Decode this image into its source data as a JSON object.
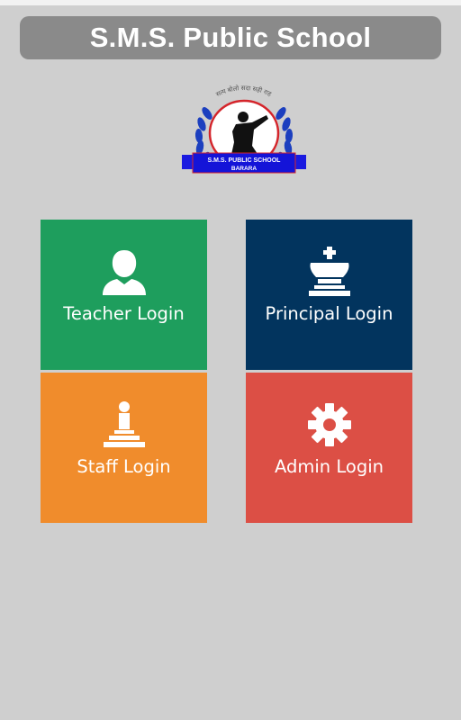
{
  "app": {
    "title": "S.M.S. Public School"
  },
  "logo": {
    "school_name": "S.M.S. PUBLIC SCHOOL",
    "location": "BARARA",
    "motto": "सत्य बोलो सदा सही राह"
  },
  "tiles": [
    {
      "label": "Teacher Login",
      "icon": "user-icon",
      "color": "#1e9e5d"
    },
    {
      "label": "Principal Login",
      "icon": "chess-king-icon",
      "color": "#02345e"
    },
    {
      "label": "Staff Login",
      "icon": "chess-pawn-icon",
      "color": "#f08c2c"
    },
    {
      "label": "Admin Login",
      "icon": "gear-icon",
      "color": "#dc4f45"
    }
  ]
}
